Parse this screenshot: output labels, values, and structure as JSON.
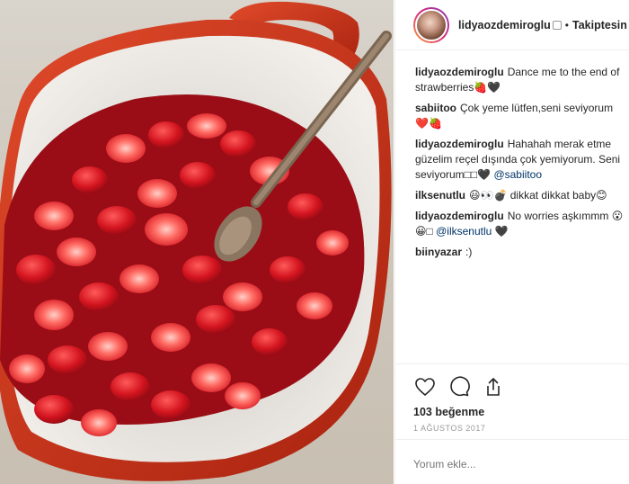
{
  "post": {
    "username": "lidyaozdemiroglu",
    "separator": "•",
    "follow_label": "Takiptesin",
    "likes": "103 beğenme",
    "date": "1 AĞUSTOS 2017",
    "comment_placeholder": "Yorum ekle..."
  },
  "comments": [
    {
      "user": "lidyaozdemiroglu",
      "text": "Dance me to the end of strawberries🍓🖤"
    },
    {
      "user": "sabiitoo",
      "text": "Çok yeme lütfen,seni seviyorum ❤️🍓"
    },
    {
      "user": "lidyaozdemiroglu",
      "text": "Hahahah merak etme güzelim reçel dışında çok yemiyorum. Seni seviyorum□□🖤 ",
      "mention": "@sabiitoo"
    },
    {
      "user": "ilksenutlu",
      "text": "😃👀💣 dikkat dikkat baby😊"
    },
    {
      "user": "lidyaozdemiroglu",
      "text": "No worries aşkımmm 😮😀□ ",
      "mention": "@ilksenutlu",
      "suffix": " 🖤"
    },
    {
      "user": "biinyazar",
      "text": ":)"
    }
  ],
  "icons": [
    "heart-icon",
    "comment-icon",
    "share-icon"
  ],
  "colors": {
    "pot_red": "#c8321c",
    "pot_inner": "#e9e6e2",
    "strawberry": "#d91f28",
    "spoon": "#8a7560"
  }
}
